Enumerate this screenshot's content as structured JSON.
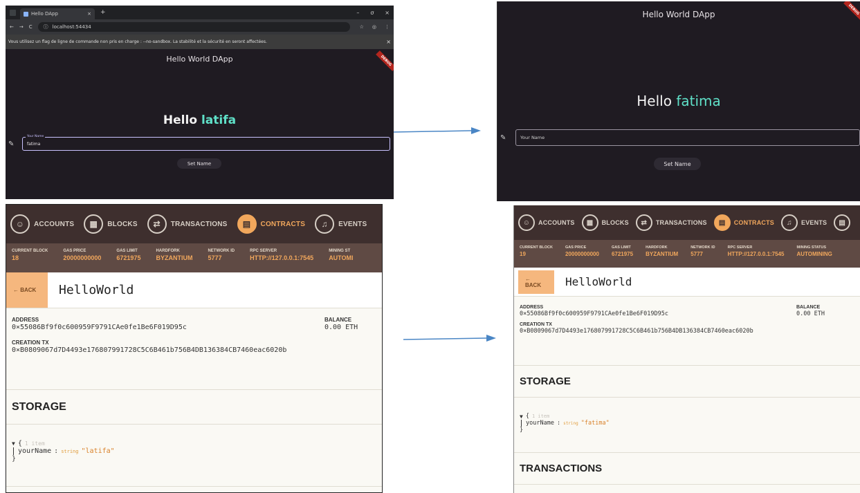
{
  "browser": {
    "tab_title": "Hello DApp",
    "url": "localhost:54434",
    "infobar_text": "Vous utilisez un flag de ligne de commande non pris en charge : --no-sandbox. La stabilité et la sécurité en seront affectées.",
    "star_glyph": "☆",
    "menu_glyph": "⋮",
    "close_glyph": "×",
    "plus_glyph": "+",
    "min_glyph": "–",
    "max_glyph": "ơ",
    "winclose_glyph": "×"
  },
  "dapp_before": {
    "app_title": "Hello World DApp",
    "debug_label": "DEBUG",
    "greeting_prefix": "Hello",
    "greeting_name": "latifa",
    "field_label": "Your Name",
    "field_value": "fatima",
    "button_label": "Set Name"
  },
  "dapp_after": {
    "app_title": "Hello World DApp",
    "debug_label": "DEBUG",
    "greeting_prefix": "Hello",
    "greeting_name": "fatima",
    "field_placeholder": "Your Name",
    "button_label": "Set Name"
  },
  "ganache_before": {
    "nav": [
      {
        "label": "ACCOUNTS",
        "glyph": "☺"
      },
      {
        "label": "BLOCKS",
        "glyph": "▦"
      },
      {
        "label": "TRANSACTIONS",
        "glyph": "⇄"
      },
      {
        "label": "CONTRACTS",
        "glyph": "▤"
      },
      {
        "label": "EVENTS",
        "glyph": "♫"
      }
    ],
    "stats": [
      {
        "label": "CURRENT BLOCK",
        "value": "18"
      },
      {
        "label": "GAS PRICE",
        "value": "20000000000"
      },
      {
        "label": "GAS LIMIT",
        "value": "6721975"
      },
      {
        "label": "HARDFORK",
        "value": "BYZANTIUM"
      },
      {
        "label": "NETWORK ID",
        "value": "5777"
      },
      {
        "label": "RPC SERVER",
        "value": "HTTP://127.0.0.1:7545"
      },
      {
        "label": "MINING ST",
        "value": "AUTOMI"
      }
    ],
    "back_label": "← BACK",
    "contract_name": "HelloWorld",
    "address_label": "ADDRESS",
    "address_value": "0×55086Bf9f0c600959F9791CAe0fe1Be6F019D95c",
    "balance_label": "BALANCE",
    "balance_value": "0.00 ETH",
    "creation_label": "CREATION TX",
    "creation_value": "0×B0809067d7D4493e176807991728C5C6B461b756B4DB136384CB7460eac6020b",
    "storage_title": "STORAGE",
    "storage_caret": "▼",
    "storage_brace_open": "{",
    "storage_item_count": "1 item",
    "storage_key": "yourName",
    "storage_colon": ":",
    "storage_type": "string",
    "storage_value": "\"latifa\"",
    "storage_brace_close": "}"
  },
  "ganache_after": {
    "nav": [
      {
        "label": "ACCOUNTS",
        "glyph": "☺"
      },
      {
        "label": "BLOCKS",
        "glyph": "▦"
      },
      {
        "label": "TRANSACTIONS",
        "glyph": "⇄"
      },
      {
        "label": "CONTRACTS",
        "glyph": "▤"
      },
      {
        "label": "EVENTS",
        "glyph": "♫"
      },
      {
        "label": "",
        "glyph": "▤"
      }
    ],
    "stats": [
      {
        "label": "CURRENT BLOCK",
        "value": "19"
      },
      {
        "label": "GAS PRICE",
        "value": "20000000000"
      },
      {
        "label": "GAS LIMIT",
        "value": "6721975"
      },
      {
        "label": "HARDFORK",
        "value": "BYZANTIUM"
      },
      {
        "label": "NETWORK ID",
        "value": "5777"
      },
      {
        "label": "RPC SERVER",
        "value": "HTTP://127.0.0.1:7545"
      },
      {
        "label": "MINING STATUS",
        "value": "AUTOMINING"
      }
    ],
    "back_label": "← BACK",
    "contract_name": "HelloWorld",
    "address_label": "ADDRESS",
    "address_value": "0×55086Bf9f0c600959F9791CAe0fe1Be6F019D95c",
    "balance_label": "BALANCE",
    "balance_value": "0.00 ETH",
    "creation_label": "CREATION TX",
    "creation_value": "0×B0809067d7D4493e176807991728C5C6B461b756B4DB136384CB7460eac6020b",
    "storage_title": "STORAGE",
    "storage_caret": "▼",
    "storage_brace_open": "{",
    "storage_item_count": "1 item",
    "storage_key": "yourName",
    "storage_colon": ":",
    "storage_type": "string",
    "storage_value": "\"fatima\"",
    "storage_brace_close": "}",
    "transactions_title": "TRANSACTIONS"
  },
  "colors": {
    "dapp_bg": "#1f1b22",
    "greeting_accent": "#5fe0c8",
    "ganache_nav_bg": "#3e2f2e",
    "ganache_stats_bg": "#5f4a44",
    "ganache_accent": "#f1a75c",
    "arrow": "#4a86c5"
  }
}
